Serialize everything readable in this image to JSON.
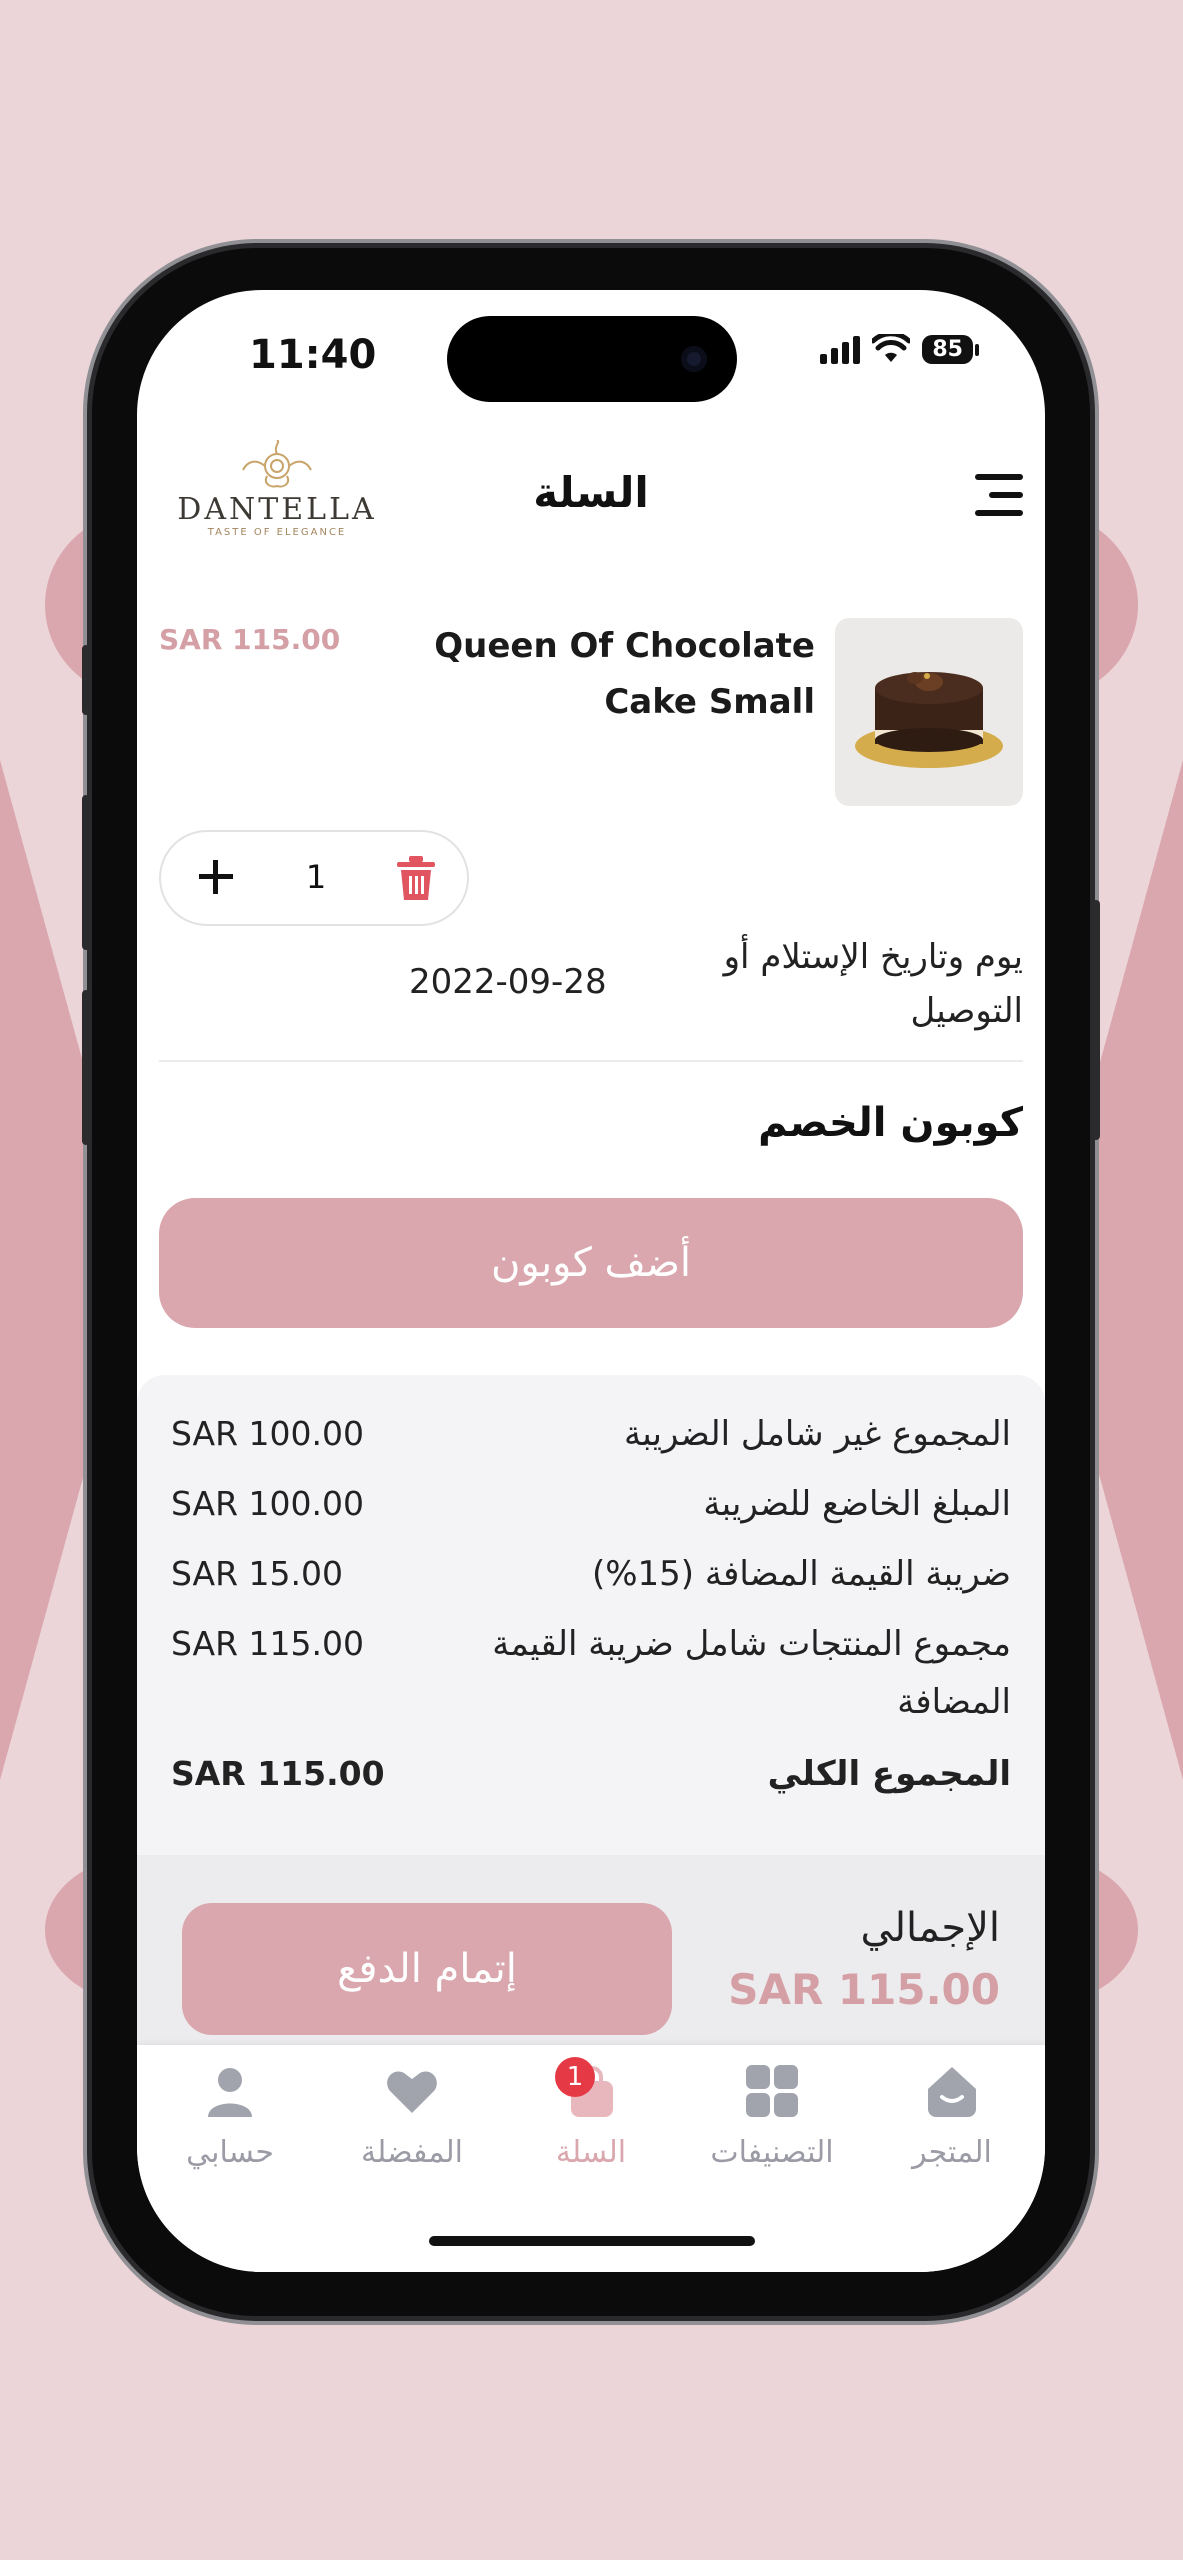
{
  "status_bar": {
    "time": "11:40",
    "battery": "85"
  },
  "header": {
    "logo_name": "DANTELLA",
    "logo_tagline": "TASTE OF ELEGANCE",
    "title": "السلة",
    "menu_icon": "hamburger-icon"
  },
  "cart_item": {
    "name_line1": "Queen Of Chocolate",
    "name_line2": "Cake Small",
    "price": "SAR 115.00",
    "quantity": "1",
    "delivery_label": "يوم وتاريخ الإستلام أو التوصيل",
    "delivery_date": "2022-09-28"
  },
  "coupon": {
    "title": "كوبون الخصم",
    "button_label": "أضف كوبون"
  },
  "summary": {
    "rows": [
      {
        "label": "المجموع غير شامل الضريبة",
        "value": "SAR 100.00"
      },
      {
        "label": "المبلغ الخاضع للضريبة",
        "value": "SAR 100.00"
      },
      {
        "label": "ضريبة القيمة المضافة (15%)",
        "value": "SAR 15.00"
      },
      {
        "label": "مجموع المنتجات شامل ضريبة القيمة المضافة",
        "value": "SAR 115.00"
      },
      {
        "label": "المجموع الكلي",
        "value": "SAR 115.00"
      }
    ]
  },
  "checkout": {
    "total_label": "الإجمالي",
    "total_value": "SAR 115.00",
    "pay_button": "إتمام الدفع"
  },
  "tabbar": {
    "tabs": [
      {
        "label": "حسابي",
        "icon": "person-icon"
      },
      {
        "label": "المفضلة",
        "icon": "heart-icon"
      },
      {
        "label": "السلة",
        "icon": "bag-icon",
        "badge": "1",
        "active": true
      },
      {
        "label": "التصنيفات",
        "icon": "grid-icon"
      },
      {
        "label": "المتجر",
        "icon": "store-icon"
      }
    ]
  },
  "colors": {
    "accent": "#d9a7ad",
    "price": "#d49fa5",
    "badge": "#e63946",
    "background": "#ecd5d8"
  }
}
